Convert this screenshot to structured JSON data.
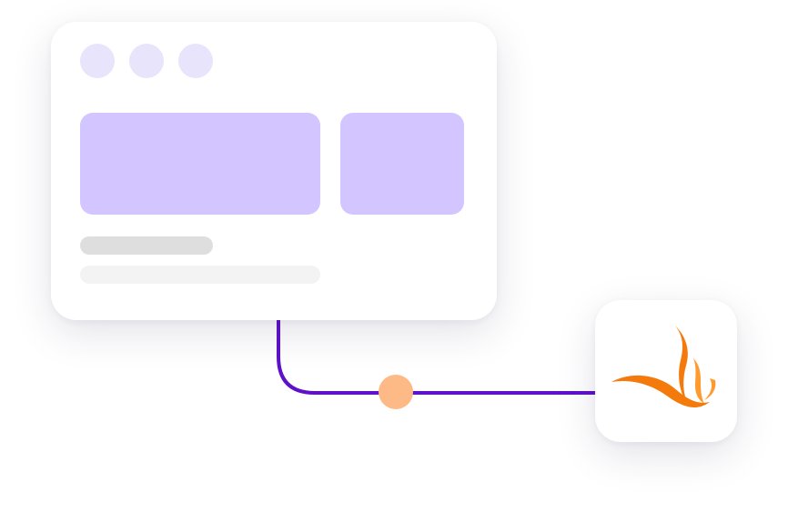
{
  "colors": {
    "window_dot": "#e8e4fc",
    "panel": "#d3c5ff",
    "text_line_primary": "#dedede",
    "text_line_secondary": "#f3f3f3",
    "connector": "#5d12c9",
    "flow_node": "#fdb986",
    "logo_orange": "#f47a0c",
    "logo_orange_light": "#ff9a2e"
  },
  "window": {
    "dots": [
      {
        "name": "window-dot-1"
      },
      {
        "name": "window-dot-2"
      },
      {
        "name": "window-dot-3"
      }
    ]
  },
  "app_tile": {
    "icon": "flame-logo-icon"
  },
  "connector": {
    "node_icon": "flow-node-dot"
  }
}
